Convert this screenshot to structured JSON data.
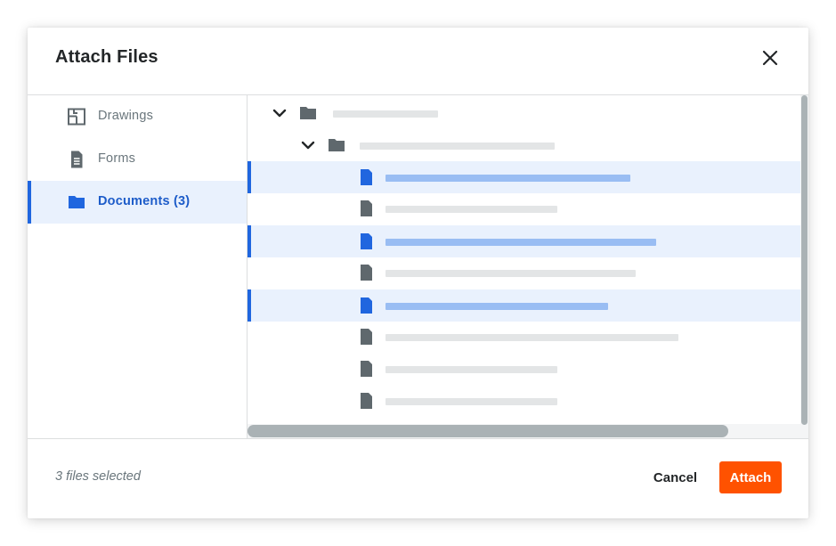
{
  "dialog": {
    "title": "Attach Files",
    "close_icon": "close-icon"
  },
  "sidebar": {
    "items": [
      {
        "label": "Drawings",
        "icon": "drawing-icon",
        "active": false
      },
      {
        "label": "Forms",
        "icon": "form-document-icon",
        "active": false
      },
      {
        "label": "Documents (3)",
        "icon": "folder-icon",
        "active": true
      }
    ]
  },
  "tree": {
    "rows": [
      {
        "type": "folder",
        "level": 0,
        "expanded": true,
        "selected": false,
        "name": ""
      },
      {
        "type": "folder",
        "level": 1,
        "expanded": true,
        "selected": false,
        "name": ""
      },
      {
        "type": "file",
        "level": 2,
        "selected": true,
        "name": ""
      },
      {
        "type": "file",
        "level": 2,
        "selected": false,
        "name": ""
      },
      {
        "type": "file",
        "level": 2,
        "selected": true,
        "name": ""
      },
      {
        "type": "file",
        "level": 2,
        "selected": false,
        "name": ""
      },
      {
        "type": "file",
        "level": 2,
        "selected": true,
        "name": ""
      },
      {
        "type": "file",
        "level": 2,
        "selected": false,
        "name": ""
      },
      {
        "type": "file",
        "level": 2,
        "selected": false,
        "name": ""
      },
      {
        "type": "file",
        "level": 2,
        "selected": false,
        "name": ""
      }
    ]
  },
  "footer": {
    "status": "3 files selected",
    "cancel_label": "Cancel",
    "attach_label": "Attach"
  },
  "colors": {
    "accent": "#2066df",
    "selected_bg": "#e9f1fd",
    "primary_button": "#ff5200",
    "icon_gray": "#5f686d"
  }
}
